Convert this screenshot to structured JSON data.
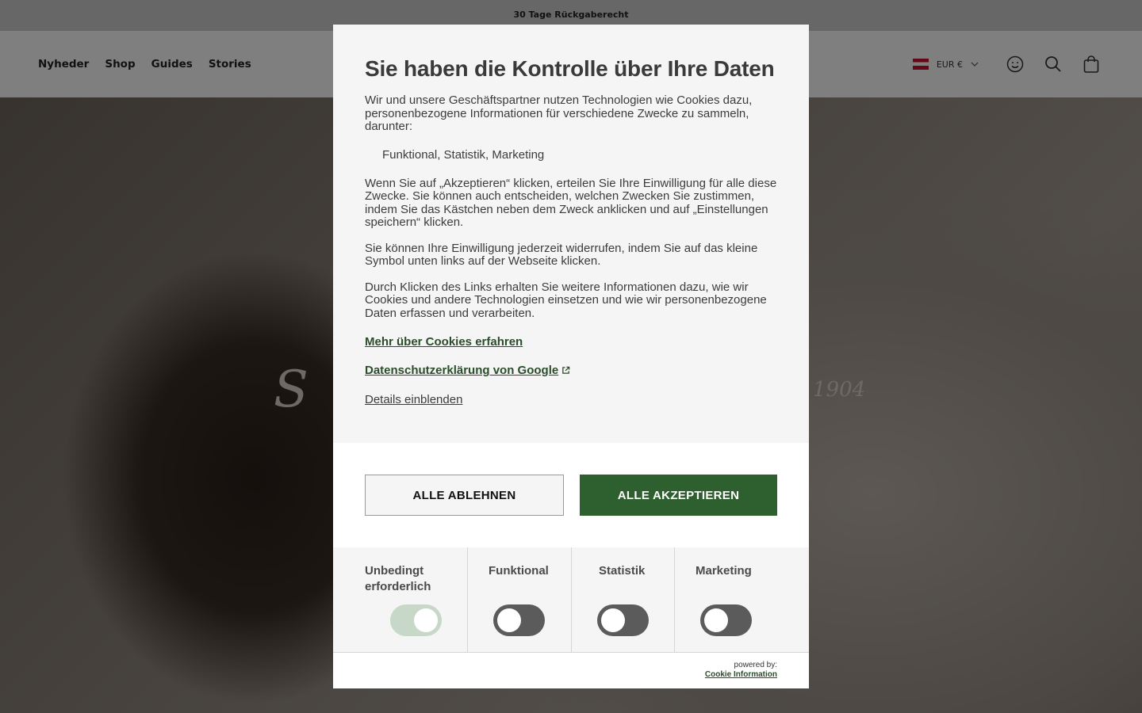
{
  "site": {
    "announcement": "30 Tage Rückgaberecht",
    "nav": [
      "Nyheder",
      "Shop",
      "Guides",
      "Stories"
    ],
    "currency": "EUR €",
    "hero_script_left": "S",
    "hero_script_right": "1904",
    "icons": [
      "flag-icon",
      "chevron-down-icon",
      "account-icon",
      "search-icon",
      "bag-icon"
    ]
  },
  "consent": {
    "title": "Sie haben die Kontrolle über Ihre Daten",
    "intro": "Wir und unsere Geschäftspartner nutzen Technologien wie Cookies dazu, personenbezogene Informationen für verschiedene Zwecke zu sammeln, darunter:",
    "purposes": "Funktional,  Statistik,  Marketing",
    "para_accept": "Wenn Sie auf „Akzeptieren“ klicken, erteilen Sie Ihre Einwilligung für alle diese Zwecke. Sie können auch entscheiden, welchen Zwecken Sie zustimmen, indem Sie das Kästchen neben dem Zweck anklicken und auf „Einstellungen speichern“ klicken.",
    "para_withdraw": "Sie können Ihre Einwilligung jederzeit widerrufen, indem Sie auf das kleine Symbol unten links auf der Webseite klicken.",
    "para_links": "Durch Klicken des Links erhalten Sie weitere Informationen dazu, wie wir Cookies und andere Technologien einsetzen und wie wir personenbezogene Daten erfassen und verarbeiten.",
    "link_cookies": "Mehr über Cookies erfahren",
    "link_google": "Datenschutzerklärung von Google",
    "link_details": "Details einblenden",
    "btn_reject": "ALLE ABLEHNEN",
    "btn_accept": "ALLE AKZEPTIEREN",
    "categories": [
      {
        "label": "Unbedingt erforderlich",
        "enabled": true
      },
      {
        "label": "Funktional",
        "enabled": false
      },
      {
        "label": "Statistik",
        "enabled": false
      },
      {
        "label": "Marketing",
        "enabled": false
      }
    ],
    "powered_by": "powered by:",
    "brand": "Cookie Information",
    "colors": {
      "accent": "#2e5f2e",
      "link": "#2a4d2a",
      "toggle_off": "#5b5b5b",
      "toggle_on_disabled": "#c8d8c8"
    }
  }
}
